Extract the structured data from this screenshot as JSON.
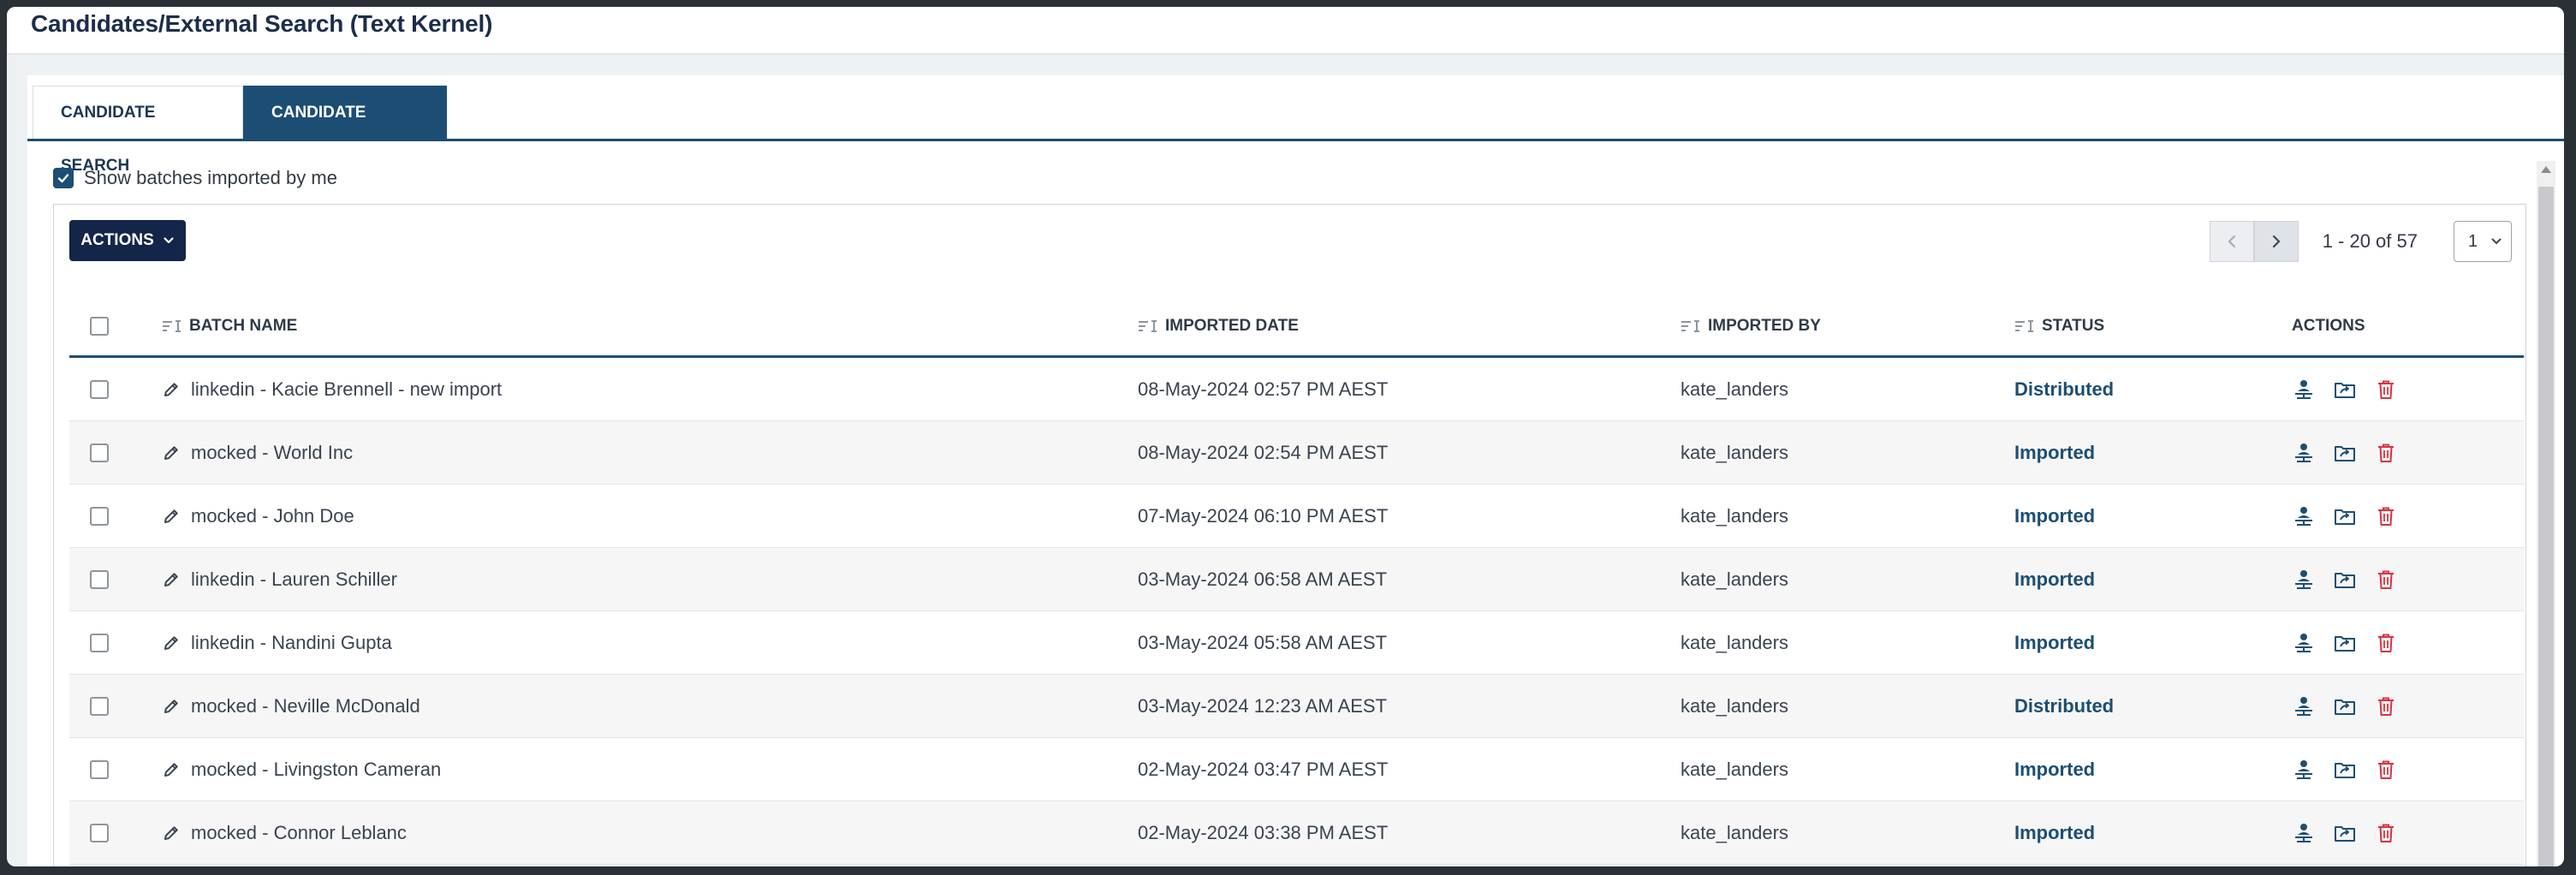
{
  "header": {
    "title": "Candidates/External Search (Text Kernel)"
  },
  "tabs": [
    {
      "label": "CANDIDATE SEARCH"
    },
    {
      "label": "CANDIDATE IMPORT"
    }
  ],
  "filter": {
    "show_mine_label": "Show batches imported by me",
    "show_mine_checked": true
  },
  "toolbar": {
    "actions_label": "ACTIONS"
  },
  "pager": {
    "range_text": "1 - 20 of 57",
    "page_selected": "1"
  },
  "table": {
    "headers": {
      "batch_name": "BATCH NAME",
      "imported_date": "IMPORTED DATE",
      "imported_by": "IMPORTED BY",
      "status": "STATUS",
      "actions": "ACTIONS"
    },
    "rows": [
      {
        "name": "linkedin - Kacie Brennell - new import",
        "date": "08-May-2024 02:57 PM AEST",
        "by": "kate_landers",
        "status": "Distributed"
      },
      {
        "name": "mocked - World Inc",
        "date": "08-May-2024 02:54 PM AEST",
        "by": "kate_landers",
        "status": "Imported"
      },
      {
        "name": "mocked - John Doe",
        "date": "07-May-2024 06:10 PM AEST",
        "by": "kate_landers",
        "status": "Imported"
      },
      {
        "name": "linkedin - Lauren Schiller",
        "date": "03-May-2024 06:58 AM AEST",
        "by": "kate_landers",
        "status": "Imported"
      },
      {
        "name": "linkedin - Nandini Gupta",
        "date": "03-May-2024 05:58 AM AEST",
        "by": "kate_landers",
        "status": "Imported"
      },
      {
        "name": "mocked - Neville McDonald",
        "date": "03-May-2024 12:23 AM AEST",
        "by": "kate_landers",
        "status": "Distributed"
      },
      {
        "name": "mocked - Livingston Cameran",
        "date": "02-May-2024 03:47 PM AEST",
        "by": "kate_landers",
        "status": "Imported"
      },
      {
        "name": "mocked - Connor Leblanc",
        "date": "02-May-2024 03:38 PM AEST",
        "by": "kate_landers",
        "status": "Imported"
      }
    ]
  },
  "icons": {
    "row_actions": [
      "distribute-candidate-icon",
      "open-folder-icon",
      "delete-icon"
    ]
  },
  "colors": {
    "primary": "#1c4e74",
    "actions_button": "#14254a",
    "delete": "#d9333f"
  }
}
